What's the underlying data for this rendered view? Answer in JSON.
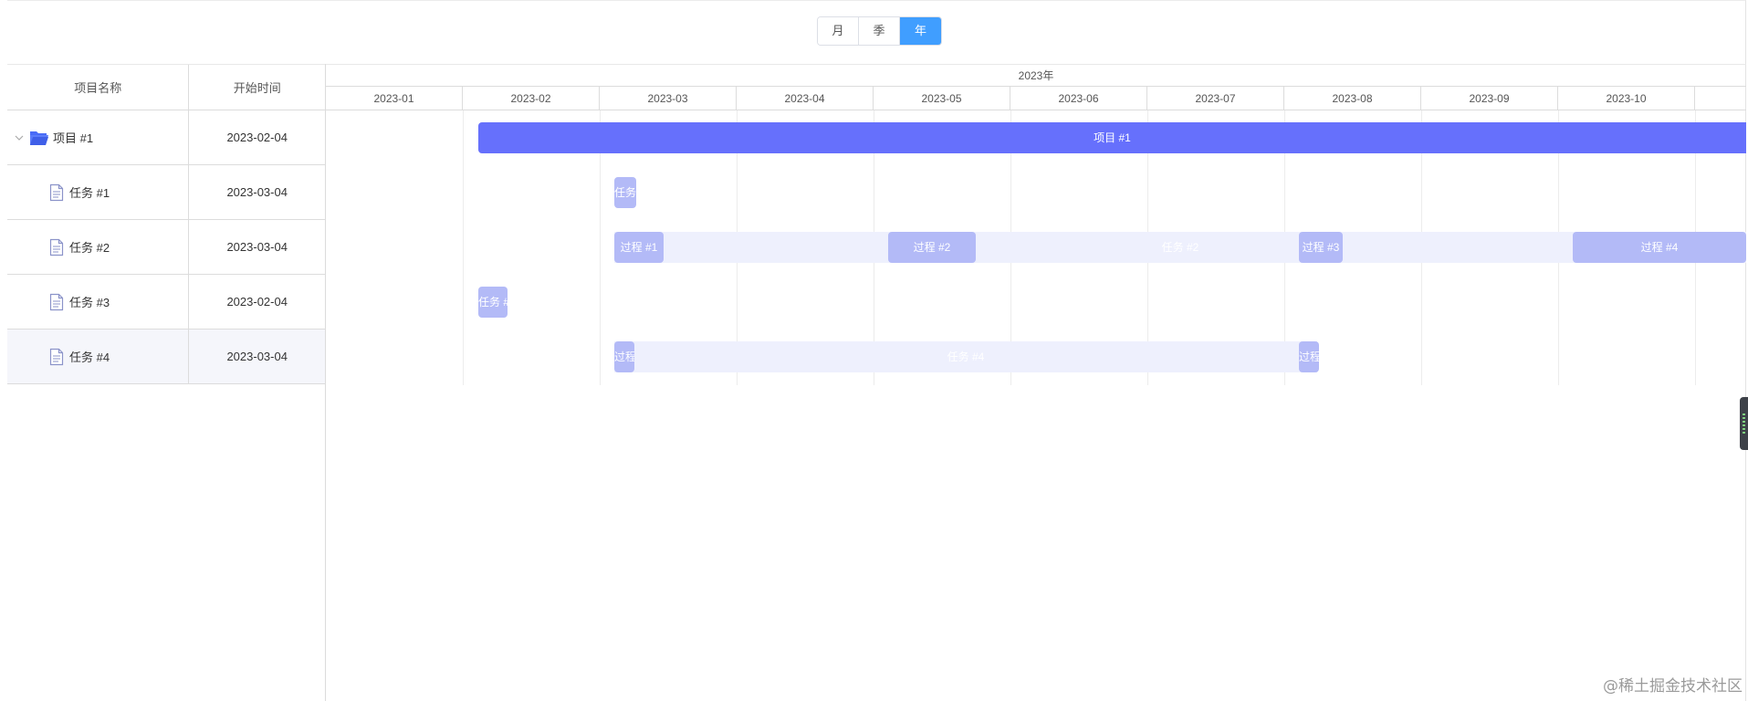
{
  "view_switcher": {
    "options": [
      "月",
      "季",
      "年"
    ],
    "active": "年"
  },
  "grid": {
    "columns": {
      "name": "项目名称",
      "start": "开始时间"
    },
    "rows": [
      {
        "name": "项目 #1",
        "start": "2023-02-04",
        "type": "project",
        "expanded": true,
        "icon": "folder-open-icon"
      },
      {
        "name": "任务 #1",
        "start": "2023-03-04",
        "type": "task",
        "icon": "document-icon"
      },
      {
        "name": "任务 #2",
        "start": "2023-03-04",
        "type": "task",
        "icon": "document-icon"
      },
      {
        "name": "任务 #3",
        "start": "2023-02-04",
        "type": "task",
        "icon": "document-icon"
      },
      {
        "name": "任务 #4",
        "start": "2023-03-04",
        "type": "task",
        "icon": "document-icon",
        "selected": true
      }
    ]
  },
  "timeline": {
    "year": "2023年",
    "months": [
      "2023-01",
      "2023-02",
      "2023-03",
      "2023-04",
      "2023-05",
      "2023-06",
      "2023-07",
      "2023-08",
      "2023-09",
      "2023-10"
    ],
    "bars": {
      "project1": "项目 #1",
      "task1": "任务",
      "task2_track": "任务 #2",
      "task2_proc1": "过程 #1",
      "task2_proc2": "过程 #2",
      "task2_proc3": "过程 #3",
      "task2_proc4": "过程 #4",
      "task3": "任务 #",
      "task4_track": "任务 #4",
      "task4_proc1": "过程",
      "task4_proc2": "过程"
    }
  },
  "colors": {
    "accent": "#409eff",
    "project_bar": "#6670fc",
    "task_bar": "#b3baf7",
    "track": "#eef0fd"
  },
  "watermark": "@稀土掘金技术社区"
}
